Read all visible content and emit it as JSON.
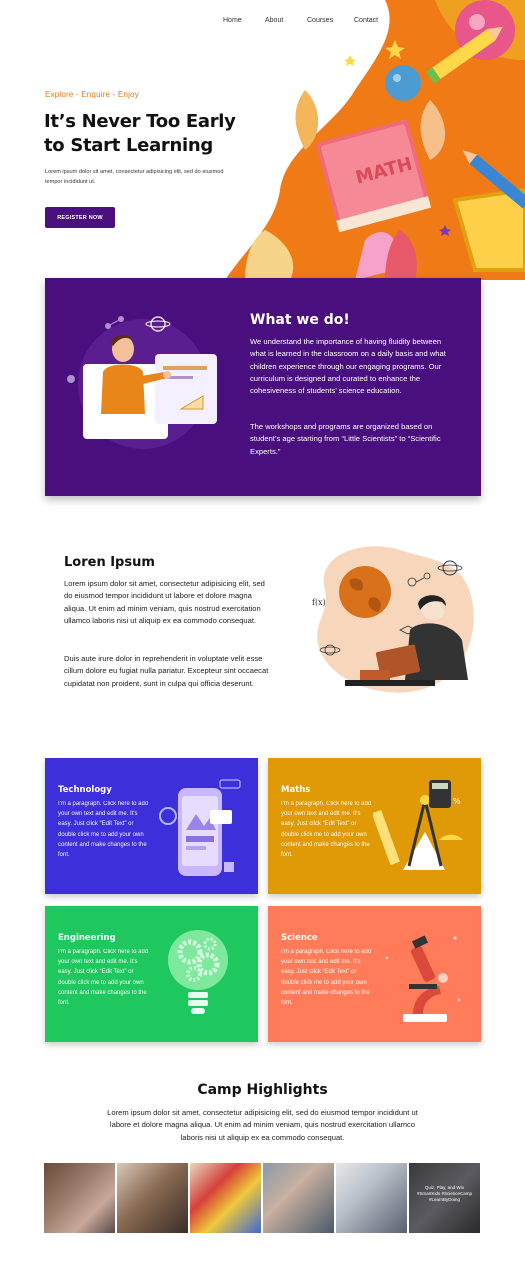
{
  "nav": {
    "items": [
      "Home",
      "About",
      "Courses",
      "Contact"
    ]
  },
  "hero": {
    "eyebrow": "Explore - Enquire - Enjoy",
    "title_line1": "It’s Never Too Early",
    "title_line2": "to Start Learning",
    "description": "Lorem ipsum dolor sit amet, consectetur adipisicing elit, sed do eiusmod tempor incididunt ut.",
    "register_label": "REGISTER NOW",
    "book_label": "MATH"
  },
  "what": {
    "title": "What we do!",
    "paragraph1": "We understand the importance of having fluidity between what is learned in the classroom on a daily basis and what children experience through our engaging programs. Our curriculum is designed and curated to enhance the cohesiveness of students’ science education.",
    "paragraph2": "The workshops and programs are organized based on student’s age starting from “Little Scientists” to “Scientific Experts.”"
  },
  "lorem": {
    "title": "Loren Ipsum",
    "paragraph1": "Lorem ipsum dolor sit amet, consectetur adipisicing elit, sed do eiusmod tempor incididunt ut labore et dolore magna aliqua. Ut enim ad minim veniam, quis nostrud exercitation ullamco laboris nisi ut aliquip ex ea commodo consequat.",
    "paragraph2": "Duis aute irure dolor in reprehenderit in voluptate velit esse cillum dolore eu fugiat nulla pariatur. Excepteur sint occaecat cupidatat non proident, sunt in culpa qui officia deserunt."
  },
  "cards": [
    {
      "title": "Technology",
      "text": "I'm a paragraph. Click here to add your own text and edit me. It's easy. Just click “Edit Text” or double click me to add your own content and make changes to the font.",
      "color": "#3d2fd9"
    },
    {
      "title": "Maths",
      "text": "I'm a paragraph. Click here to add your own text and edit me. It's easy. Just click “Edit Text” or double click me to add your own content and make changes to the font.",
      "color": "#e09a08"
    },
    {
      "title": "Engineering",
      "text": "I'm a paragraph. Click here to add your own text and edit me. It's easy. Just click “Edit Text” or double click me to add your own content and make changes to the font.",
      "color": "#1fc85e"
    },
    {
      "title": "Science",
      "text": "I'm a paragraph. Click here to add your own text and edit me. It's easy. Just click “Edit Text” or double click me to add your own content and make changes to the font.",
      "color": "#ff7b5a"
    }
  ],
  "camp": {
    "title": "Camp Highlights",
    "paragraph": "Lorem ipsum dolor sit amet, consectetur adipisicing elit, sed do eiusmod tempor incididunt ut labore et dolore magna aliqua. Ut enim ad minim veniam, quis nostrud exercitation ullamco laboris nisi ut aliquip ex ea commodo consequat.",
    "photo_caption": "Quiz, Play, and Win #SmartKids #ScienceCamp #LearnByDoing"
  },
  "colors": {
    "brand": "#4a1080",
    "accent": "#e07a16",
    "what_bg": "#4a0f7e"
  }
}
